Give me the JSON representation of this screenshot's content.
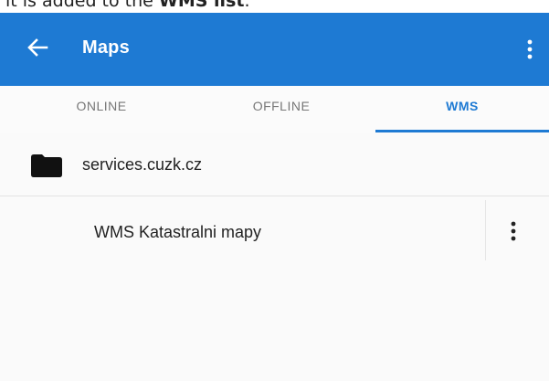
{
  "caption": {
    "text_prefix": "it is added to the ",
    "text_bold": "WMS list",
    "text_suffix": "."
  },
  "appbar": {
    "title": "Maps",
    "back_icon": "arrow-left-icon",
    "menu_icon": "more-vertical-icon",
    "color": "#1e7ad3"
  },
  "tabs": [
    {
      "label": "ONLINE",
      "active": false
    },
    {
      "label": "OFFLINE",
      "active": false
    },
    {
      "label": "WMS",
      "active": true
    }
  ],
  "list": {
    "folder": {
      "label": "services.cuzk.cz",
      "icon": "folder-icon"
    },
    "items": [
      {
        "label": "WMS Katastralni mapy",
        "menu_icon": "more-vertical-icon"
      }
    ]
  }
}
